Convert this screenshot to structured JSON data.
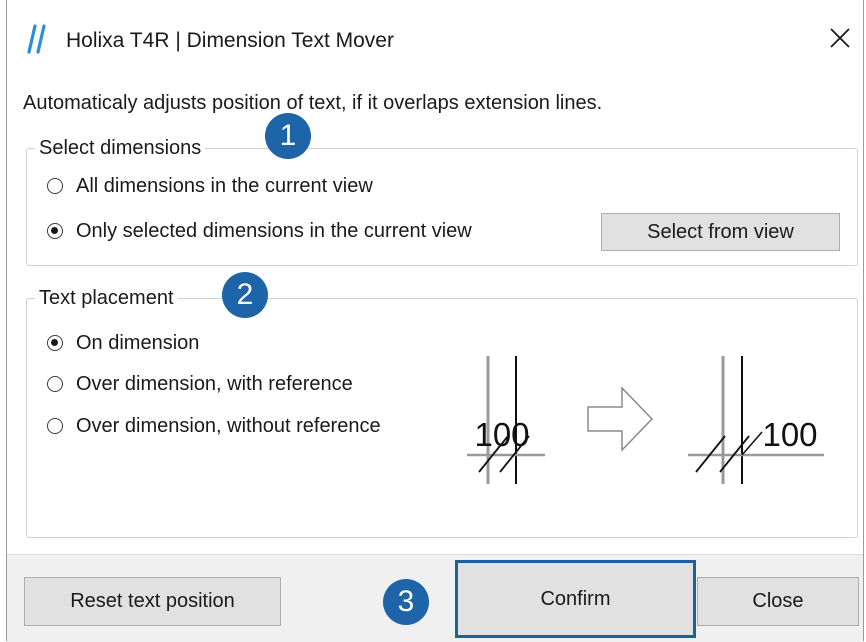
{
  "window": {
    "title": "Holixa T4R | Dimension Text Mover",
    "logo_icon": "holixa-logo-icon",
    "close_icon": "close-icon",
    "close_glyph": "✕"
  },
  "description": "Automaticaly adjusts position of text, if it overlaps extension lines.",
  "select_dimensions": {
    "legend": "Select dimensions",
    "options": [
      {
        "label": "All dimensions in the current view",
        "checked": false
      },
      {
        "label": "Only selected dimensions in the current view",
        "checked": true
      }
    ],
    "select_button": "Select from view"
  },
  "text_placement": {
    "legend": "Text placement",
    "options": [
      {
        "label": "On dimension",
        "checked": true
      },
      {
        "label": "Over dimension, with reference",
        "checked": false
      },
      {
        "label": "Over dimension, without reference",
        "checked": false
      }
    ],
    "illustration": {
      "before_text": "100",
      "after_text": "100",
      "arrow_icon": "right-arrow-icon"
    }
  },
  "footer": {
    "reset_button": "Reset text position",
    "confirm_button": "Confirm",
    "close_button": "Close"
  },
  "badges": [
    "1",
    "2",
    "3"
  ],
  "colors": {
    "badge": "#1e64a8",
    "focus_border": "#1f5f9e",
    "button_bg": "#e1e1e1",
    "footer_bg": "#f0f0f0"
  }
}
